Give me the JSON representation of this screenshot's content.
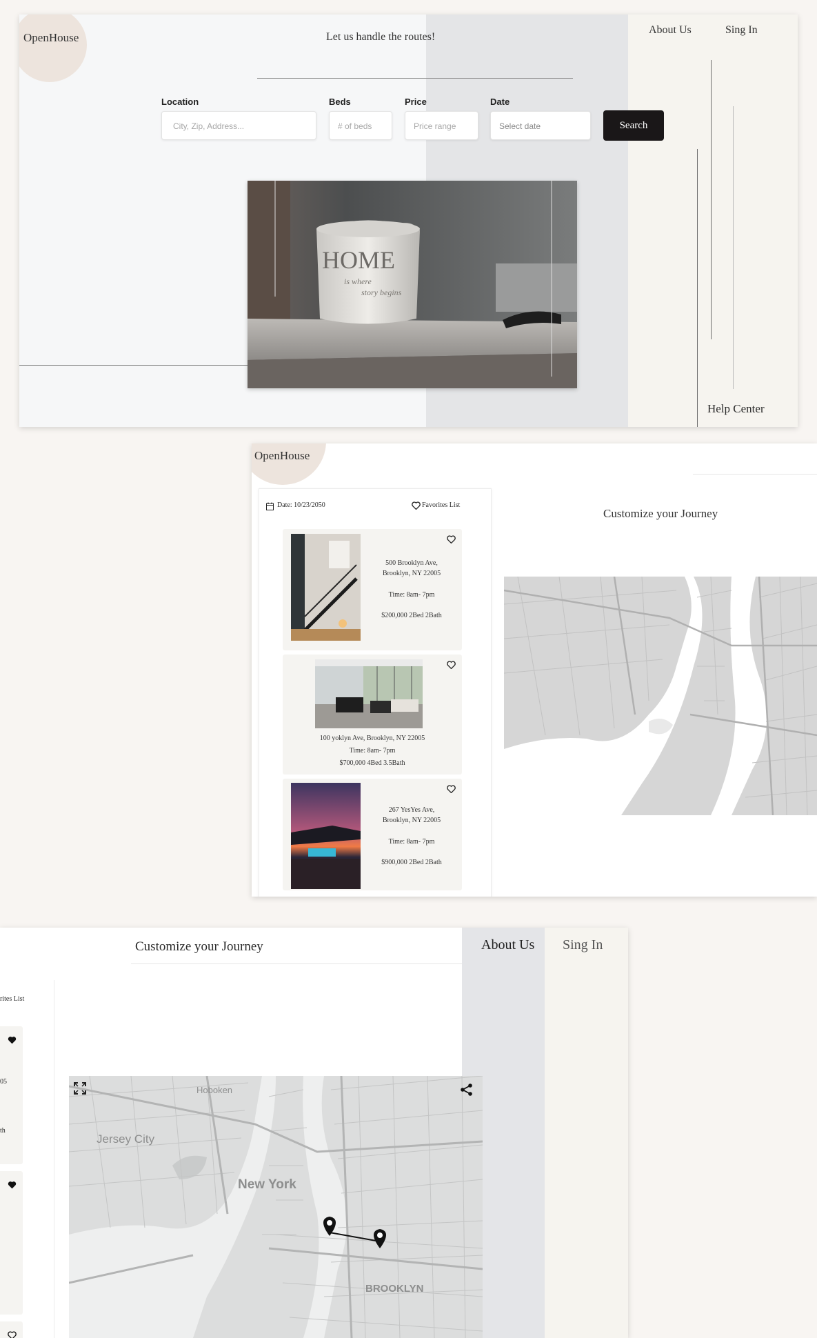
{
  "panel1": {
    "logo": "OpenHouse",
    "tagline": "Let us handle the routes!",
    "nav": {
      "about": "About Us",
      "signin": "Sing In",
      "help": "Help Center"
    },
    "search": {
      "location": {
        "label": "Location",
        "placeholder": "City, Zip, Address..."
      },
      "beds": {
        "label": "Beds",
        "placeholder": "# of beds"
      },
      "price": {
        "label": "Price",
        "placeholder": "Price range"
      },
      "date": {
        "label": "Date",
        "placeholder": "Select date"
      },
      "button": "Search"
    },
    "hero_image": {
      "main_text": "HOME",
      "script_line1": "is where",
      "script_line2": "story begins"
    }
  },
  "panel2": {
    "logo": "OpenHouse",
    "date_label": "Date: 10/23/2050",
    "favorites_label": "Favorites List",
    "heading": "Customize your Journey",
    "listings": [
      {
        "address1": "500 Brooklyn Ave,",
        "address2": "Brooklyn, NY 22005",
        "time": "Time: 8am- 7pm",
        "details": "$200,000  2Bed 2Bath"
      },
      {
        "address1": "100 yoklyn Ave, Brooklyn, NY 22005",
        "time": "Time: 8am- 7pm",
        "details": "$700,000  4Bed 3.5Bath"
      },
      {
        "address1": "267 YesYes Ave,",
        "address2": "Brooklyn, NY 22005",
        "time": "Time: 8am- 7pm",
        "details": "$900,000  2Bed 2Bath"
      }
    ]
  },
  "panel3": {
    "heading": "Customize your Journey",
    "nav": {
      "about": "About Us",
      "signin": "Sing In"
    },
    "partial_favorites": "rites List",
    "partial_num": "05",
    "partial_th": "th",
    "map_labels": {
      "hoboken": "Hoboken",
      "jersey_city": "Jersey City",
      "new_york": "New York",
      "brooklyn": "BROOKLYN"
    }
  },
  "colors": {
    "page_bg": "#f8f5f2",
    "accent_dark": "#1a1718",
    "grey_band": "#e4e5e7",
    "beige_band": "#f6f4ef",
    "logo_circle": "#ede4dd"
  }
}
